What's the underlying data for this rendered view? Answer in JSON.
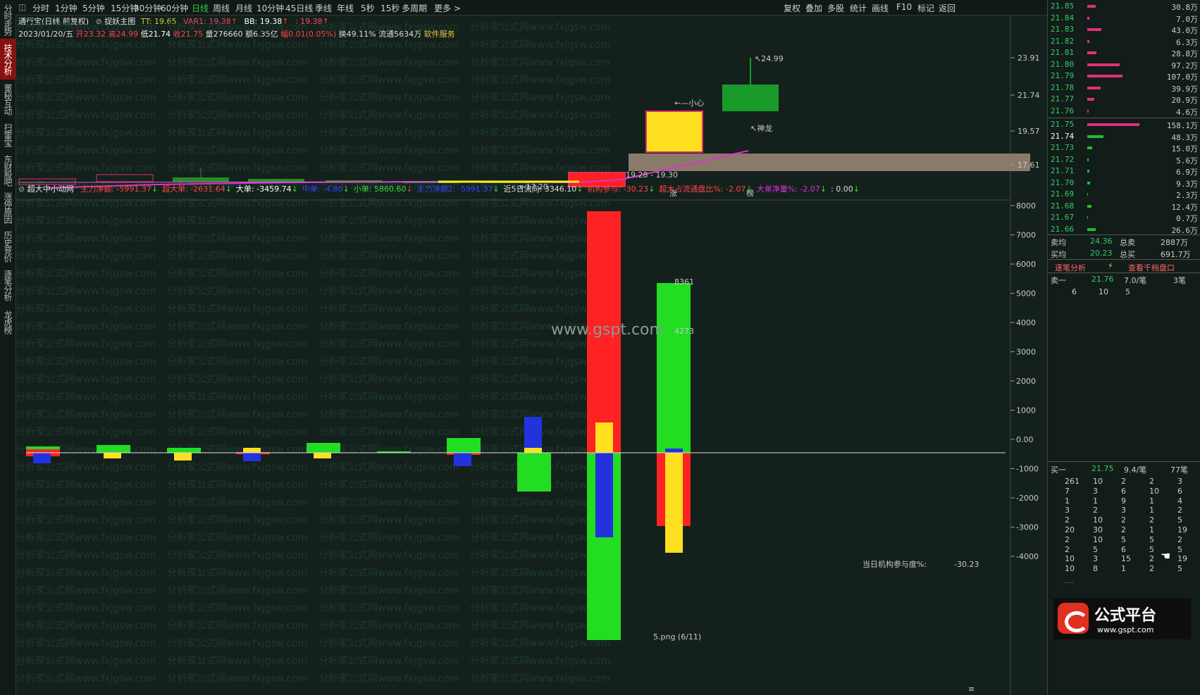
{
  "left_tabs": [
    "分时走势",
    "技术分析",
    "董秘互动",
    "扫雷宝",
    "东财股吧",
    "涨停原因",
    "历史竞价",
    "逐笔分析",
    "龙虎榜"
  ],
  "left_tab_active": 1,
  "period_tabs": [
    "分时",
    "1分钟",
    "5分钟",
    "15分钟",
    "30分钟",
    "60分钟",
    "日线",
    "周线",
    "月线",
    "10分钟",
    "45日线",
    "季线",
    "年线",
    "5秒",
    "15秒",
    "多周期",
    "更多 >"
  ],
  "period_selected": "日线",
  "toolbar_right": [
    "复权",
    "叠加",
    "多股",
    "统计",
    "画线",
    "F10",
    "标记",
    "返回"
  ],
  "stock": {
    "title": "通行宝(日线 前复权)",
    "indicator_name": "捉妖主图",
    "tt": "TT: 19.65",
    "var1": "VAR1: 19.38",
    "bb": "BB: 19.38",
    "extra": ": 19.38",
    "date": "2023/01/20/五",
    "open": "开23.32",
    "high": "高24.99",
    "low": "低21.74",
    "close": "收21.75",
    "volume": "量276660",
    "amount": "额6.35亿",
    "change": "幅0.01(0.05%)",
    "turnover": "换49.11%",
    "float": "流通5634万",
    "service": "软件服务"
  },
  "main_chart": {
    "annotations": {
      "high": "24.99",
      "warn": "小心",
      "dragon": "神龙",
      "range": "19.28 - 19.30",
      "low": "17.20",
      "zhang": "涨",
      "bang": "榜"
    },
    "yticks": [
      "23.91",
      "21.74",
      "19.57",
      "17.61"
    ]
  },
  "sub_chart": {
    "title": "超大中小动网",
    "items": [
      {
        "label": "主力净额: -5991.37",
        "color": "#ff4444"
      },
      {
        "label": "超大单: -2631.64",
        "color": "#ff4444"
      },
      {
        "label": "大单: -3459.74",
        "color": "#ffffff"
      },
      {
        "label": "中单: -4.80",
        "color": "#3344ff"
      },
      {
        "label": "小单: 5860.60",
        "color": "#33dd33"
      },
      {
        "label": "主力净额2: -5991.37",
        "color": "#3344ff"
      },
      {
        "label": "近5日流向: 3346.10",
        "color": "#dddddd"
      },
      {
        "label": "机构参与: -30.23",
        "color": "#ff4444"
      },
      {
        "label": "超大占流通盘比%: -2.07",
        "color": "#ff4444"
      },
      {
        "label": "大单净量%: -2.07",
        "color": "#dd33dd"
      },
      {
        "label": ": 0.00",
        "color": "#dddddd"
      }
    ],
    "bar_labels": [
      "8361",
      "4273"
    ],
    "yticks": [
      "8000",
      "7000",
      "6000",
      "5000",
      "4000",
      "3000",
      "2000",
      "1000",
      "0.00",
      "-1000",
      "-2000",
      "-3000",
      "-4000"
    ],
    "institution_label": "当日机构参与度%:",
    "institution_value": "-30.23",
    "watermark_center": "www.gspt.com",
    "watermark_text": "分析家公式网www.fxjgsw.com",
    "file_label": "5.png (6/11)"
  },
  "order_book": {
    "asks": [
      {
        "price": "21.85",
        "vol": "30.8万",
        "w": 0.12
      },
      {
        "price": "21.84",
        "vol": "7.0万",
        "w": 0.03
      },
      {
        "price": "21.83",
        "vol": "43.0万",
        "w": 0.2
      },
      {
        "price": "21.82",
        "vol": "6.3万",
        "w": 0.03
      },
      {
        "price": "21.81",
        "vol": "28.8万",
        "w": 0.13
      },
      {
        "price": "21.80",
        "vol": "97.2万",
        "w": 0.46
      },
      {
        "price": "21.79",
        "vol": "107.0万",
        "w": 0.5
      },
      {
        "price": "21.78",
        "vol": "39.9万",
        "w": 0.19
      },
      {
        "price": "21.77",
        "vol": "20.9万",
        "w": 0.1
      },
      {
        "price": "21.76",
        "vol": "4.6万",
        "w": 0.02
      }
    ],
    "bids": [
      {
        "price": "21.75",
        "vol": "158.1万",
        "w": 0.74,
        "color": "#e0307a"
      },
      {
        "price": "21.74",
        "vol": "48.3万",
        "w": 0.23,
        "color": "#22bb33"
      },
      {
        "price": "21.73",
        "vol": "15.0万",
        "w": 0.07,
        "color": "#22bb33"
      },
      {
        "price": "21.72",
        "vol": "5.6万",
        "w": 0.02,
        "color": "#22bb33"
      },
      {
        "price": "21.71",
        "vol": "6.9万",
        "w": 0.03,
        "color": "#22bb33"
      },
      {
        "price": "21.70",
        "vol": "9.3万",
        "w": 0.04,
        "color": "#22bb33"
      },
      {
        "price": "21.69",
        "vol": "2.3万",
        "w": 0.01,
        "color": "#22bb33"
      },
      {
        "price": "21.68",
        "vol": "12.4万",
        "w": 0.06,
        "color": "#22bb33"
      },
      {
        "price": "21.67",
        "vol": "0.7万",
        "w": 0.01,
        "color": "#22bb33"
      },
      {
        "price": "21.66",
        "vol": "26.6万",
        "w": 0.12,
        "color": "#22bb33"
      }
    ],
    "sell_avg_label": "卖均",
    "sell_avg": "24.36",
    "sell_total_label": "总卖",
    "sell_total": "2887万",
    "buy_avg_label": "买均",
    "buy_avg": "20.23",
    "buy_total_label": "总买",
    "buy_total": "691.7万",
    "tab_left": "逐笔分析",
    "tab_right": "查看千档盘口",
    "sell1": {
      "label": "卖一",
      "price": "21.76",
      "per": "7.0/笔",
      "count": "3笔",
      "queue": [
        "6",
        "10",
        "5"
      ]
    },
    "buy1": {
      "label": "买一",
      "price": "21.75",
      "per": "9.4/笔",
      "count": "77笔",
      "rows": [
        [
          "261",
          "10",
          "2",
          "2",
          "3"
        ],
        [
          "7",
          "3",
          "6",
          "10",
          "6"
        ],
        [
          "1",
          "1",
          "9",
          "1",
          "4"
        ],
        [
          "3",
          "2",
          "3",
          "1",
          "2"
        ],
        [
          "2",
          "10",
          "2",
          "2",
          "5"
        ],
        [
          "20",
          "30",
          "2",
          "1",
          "19"
        ],
        [
          "2",
          "10",
          "5",
          "5",
          "2"
        ],
        [
          "2",
          "5",
          "6",
          "5",
          "5"
        ],
        [
          "10",
          "3",
          "15",
          "2",
          "19"
        ],
        [
          "10",
          "8",
          "1",
          "2",
          "5"
        ]
      ],
      "more": "...."
    },
    "logo_text": "公式平台",
    "logo_url": "www.gspt.com"
  }
}
